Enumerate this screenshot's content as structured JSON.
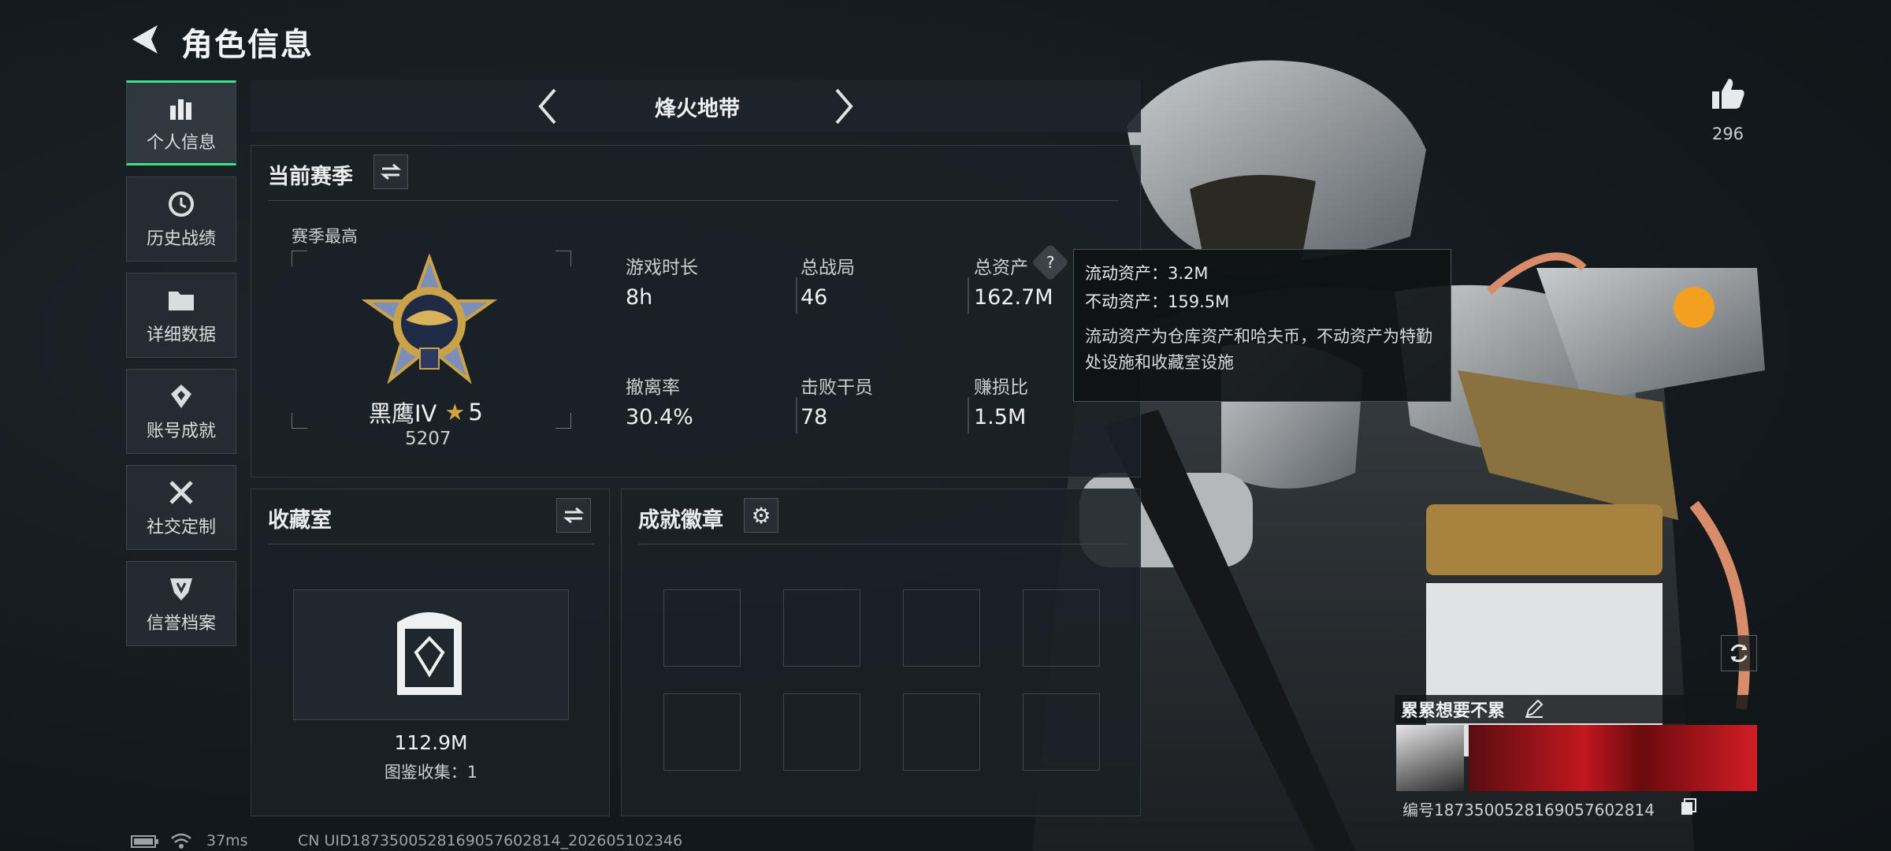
{
  "header": {
    "title": "角色信息"
  },
  "sidebar": {
    "items": [
      {
        "label": "个人信息",
        "icon": "bar-chart-icon",
        "active": true
      },
      {
        "label": "历史战绩",
        "icon": "clock-icon"
      },
      {
        "label": "详细数据",
        "icon": "folder-icon"
      },
      {
        "label": "账号成就",
        "icon": "achievement-icon"
      },
      {
        "label": "社交定制",
        "icon": "tools-icon"
      },
      {
        "label": "信誉档案",
        "icon": "shield-icon"
      }
    ]
  },
  "mode": {
    "title": "烽火地带"
  },
  "season": {
    "title": "当前赛季",
    "highest_label": "赛季最高",
    "rank_name": "黑鹰IV",
    "stars": "5",
    "rank_score": "5207",
    "stats": [
      {
        "label": "游戏时长",
        "value": "8h"
      },
      {
        "label": "总战局",
        "value": "46"
      },
      {
        "label": "总资产",
        "value": "162.7M"
      },
      {
        "label": "撤离率",
        "value": "30.4%"
      },
      {
        "label": "击败干员",
        "value": "78"
      },
      {
        "label": "赚损比",
        "value": "1.5M"
      }
    ]
  },
  "tooltip": {
    "liquid": "流动资产：3.2M",
    "fixed": "不动资产：159.5M",
    "desc": "流动资产为仓库资产和哈夫币，不动资产为特勤处设施和收藏室设施"
  },
  "collection": {
    "title": "收藏室",
    "value": "112.9M",
    "count_label": "图鉴收集：1"
  },
  "achievements": {
    "title": "成就徽章"
  },
  "likes": {
    "count": "296"
  },
  "profile": {
    "name": "累累想要不累",
    "id_label": "编号1873500528169057602814"
  },
  "status": {
    "ping": "37ms",
    "uid": "CN UID1873500528169057602814_202605102346"
  },
  "colors": {
    "accent": "#3ee08a",
    "gold": "#d4a43a"
  }
}
